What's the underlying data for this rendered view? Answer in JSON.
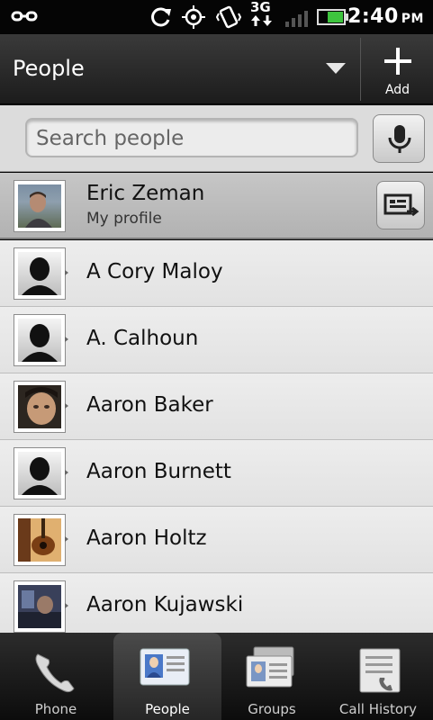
{
  "status_bar": {
    "time": "2:40",
    "ampm": "PM",
    "network": "3G",
    "icons": [
      "usb-icon",
      "sync-icon",
      "gps-icon",
      "vibrate-icon",
      "3g-icon",
      "signal-icon",
      "battery-icon"
    ]
  },
  "header": {
    "title": "People",
    "add_label": "Add"
  },
  "search": {
    "placeholder": "Search people"
  },
  "profile": {
    "name": "Eric Zeman",
    "subtitle": "My profile"
  },
  "contacts": [
    {
      "name": "A Cory Maloy",
      "photo": "silhouette"
    },
    {
      "name": "A. Calhoun",
      "photo": "silhouette"
    },
    {
      "name": "Aaron Baker",
      "photo": "face"
    },
    {
      "name": "Aaron Burnett",
      "photo": "silhouette"
    },
    {
      "name": "Aaron Holtz",
      "photo": "guitar"
    },
    {
      "name": "Aaron Kujawski",
      "photo": "dark"
    }
  ],
  "tabs": [
    {
      "label": "Phone",
      "active": false
    },
    {
      "label": "People",
      "active": true
    },
    {
      "label": "Groups",
      "active": false
    },
    {
      "label": "Call History",
      "active": false
    }
  ],
  "colors": {
    "header_bg": "#2a2a2a",
    "list_bg": "#e9e9e9",
    "battery": "#3ec43e"
  }
}
